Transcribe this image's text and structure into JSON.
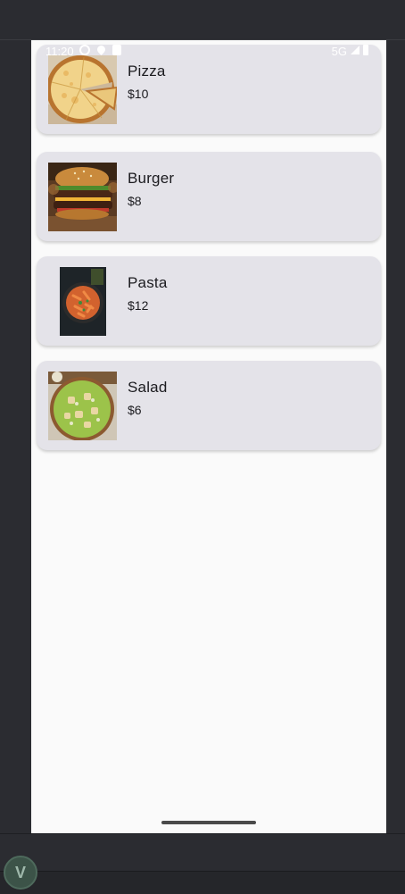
{
  "status_bar": {
    "time": "11:20",
    "network": "5G"
  },
  "menu": {
    "items": [
      {
        "name": "Pizza",
        "price": "$10",
        "image_icon": "pizza-image"
      },
      {
        "name": "Burger",
        "price": "$8",
        "image_icon": "burger-image"
      },
      {
        "name": "Pasta",
        "price": "$12",
        "image_icon": "pasta-image"
      },
      {
        "name": "Salad",
        "price": "$6",
        "image_icon": "salad-image"
      }
    ]
  },
  "colors": {
    "card_background": "#e4e3e9",
    "screen_background": "#fafafa",
    "text": "#1b1b1f",
    "emulator_frame": "#2b2c31"
  }
}
